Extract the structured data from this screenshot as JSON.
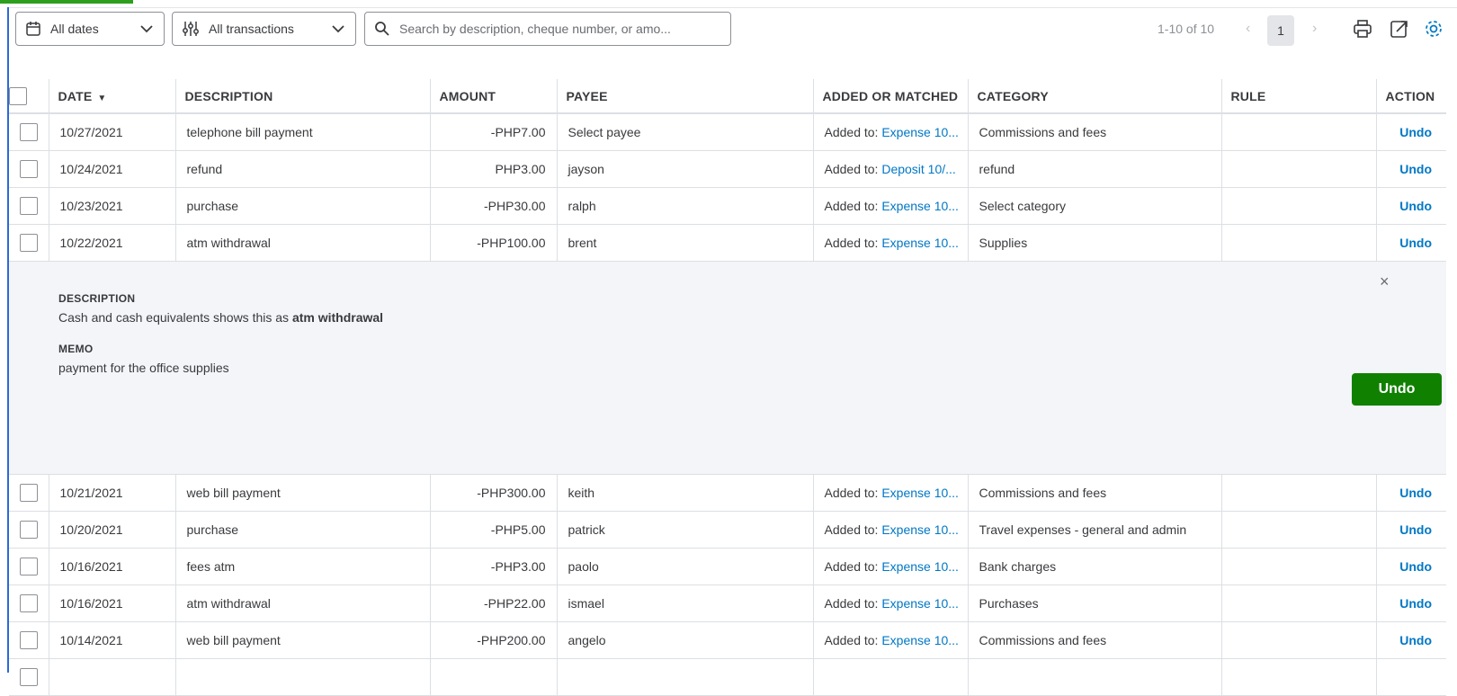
{
  "filters": {
    "dates_label": "All dates",
    "transactions_label": "All transactions",
    "search_placeholder": "Search by description, cheque number, or amo..."
  },
  "pagination": {
    "range": "1-10 of 10",
    "current_page": "1",
    "prev": "‹",
    "next": "›"
  },
  "columns": {
    "date": "DATE",
    "description": "DESCRIPTION",
    "amount": "AMOUNT",
    "payee": "PAYEE",
    "added_or_matched": "ADDED OR MATCHED",
    "category": "CATEGORY",
    "rule": "RULE",
    "action": "ACTION"
  },
  "rows_top": [
    {
      "date": "10/27/2021",
      "description": "telephone bill payment",
      "amount": "-PHP7.00",
      "payee": "Select payee",
      "added_prefix": "Added to: ",
      "added_link": "Expense 10...",
      "category": "Commissions and fees",
      "rule": "",
      "action": "Undo"
    },
    {
      "date": "10/24/2021",
      "description": "refund",
      "amount": "PHP3.00",
      "payee": "jayson",
      "added_prefix": "Added to: ",
      "added_link": "Deposit 10/...",
      "category": "refund",
      "rule": "",
      "action": "Undo"
    },
    {
      "date": "10/23/2021",
      "description": "purchase",
      "amount": "-PHP30.00",
      "payee": "ralph",
      "added_prefix": "Added to: ",
      "added_link": "Expense 10...",
      "category": "Select category",
      "rule": "",
      "action": "Undo"
    },
    {
      "date": "10/22/2021",
      "description": "atm withdrawal",
      "amount": "-PHP100.00",
      "payee": "brent",
      "added_prefix": "Added to: ",
      "added_link": "Expense 10...",
      "category": "Supplies",
      "rule": "",
      "action": "Undo"
    }
  ],
  "detail": {
    "description_label": "DESCRIPTION",
    "description_prefix": "Cash and cash equivalents shows this as ",
    "description_value": "atm withdrawal",
    "memo_label": "MEMO",
    "memo_value": "payment for the office supplies",
    "close": "×",
    "undo_button": "Undo"
  },
  "rows_bottom": [
    {
      "date": "10/21/2021",
      "description": "web bill payment",
      "amount": "-PHP300.00",
      "payee": "keith",
      "added_prefix": "Added to: ",
      "added_link": "Expense 10...",
      "category": "Commissions and fees",
      "rule": "",
      "action": "Undo"
    },
    {
      "date": "10/20/2021",
      "description": "purchase",
      "amount": "-PHP5.00",
      "payee": "patrick",
      "added_prefix": "Added to: ",
      "added_link": "Expense 10...",
      "category": "Travel expenses - general and admin",
      "rule": "",
      "action": "Undo"
    },
    {
      "date": "10/16/2021",
      "description": "fees atm",
      "amount": "-PHP3.00",
      "payee": "paolo",
      "added_prefix": "Added to: ",
      "added_link": "Expense 10...",
      "category": "Bank charges",
      "rule": "",
      "action": "Undo"
    },
    {
      "date": "10/16/2021",
      "description": "atm withdrawal",
      "amount": "-PHP22.00",
      "payee": "ismael",
      "added_prefix": "Added to: ",
      "added_link": "Expense 10...",
      "category": "Purchases",
      "rule": "",
      "action": "Undo"
    },
    {
      "date": "10/14/2021",
      "description": "web bill payment",
      "amount": "-PHP200.00",
      "payee": "angelo",
      "added_prefix": "Added to: ",
      "added_link": "Expense 10...",
      "category": "Commissions and fees",
      "rule": "",
      "action": "Undo"
    }
  ],
  "colors": {
    "link": "#0077c5",
    "primary_button": "#108000",
    "progress": "#2ca01c"
  }
}
